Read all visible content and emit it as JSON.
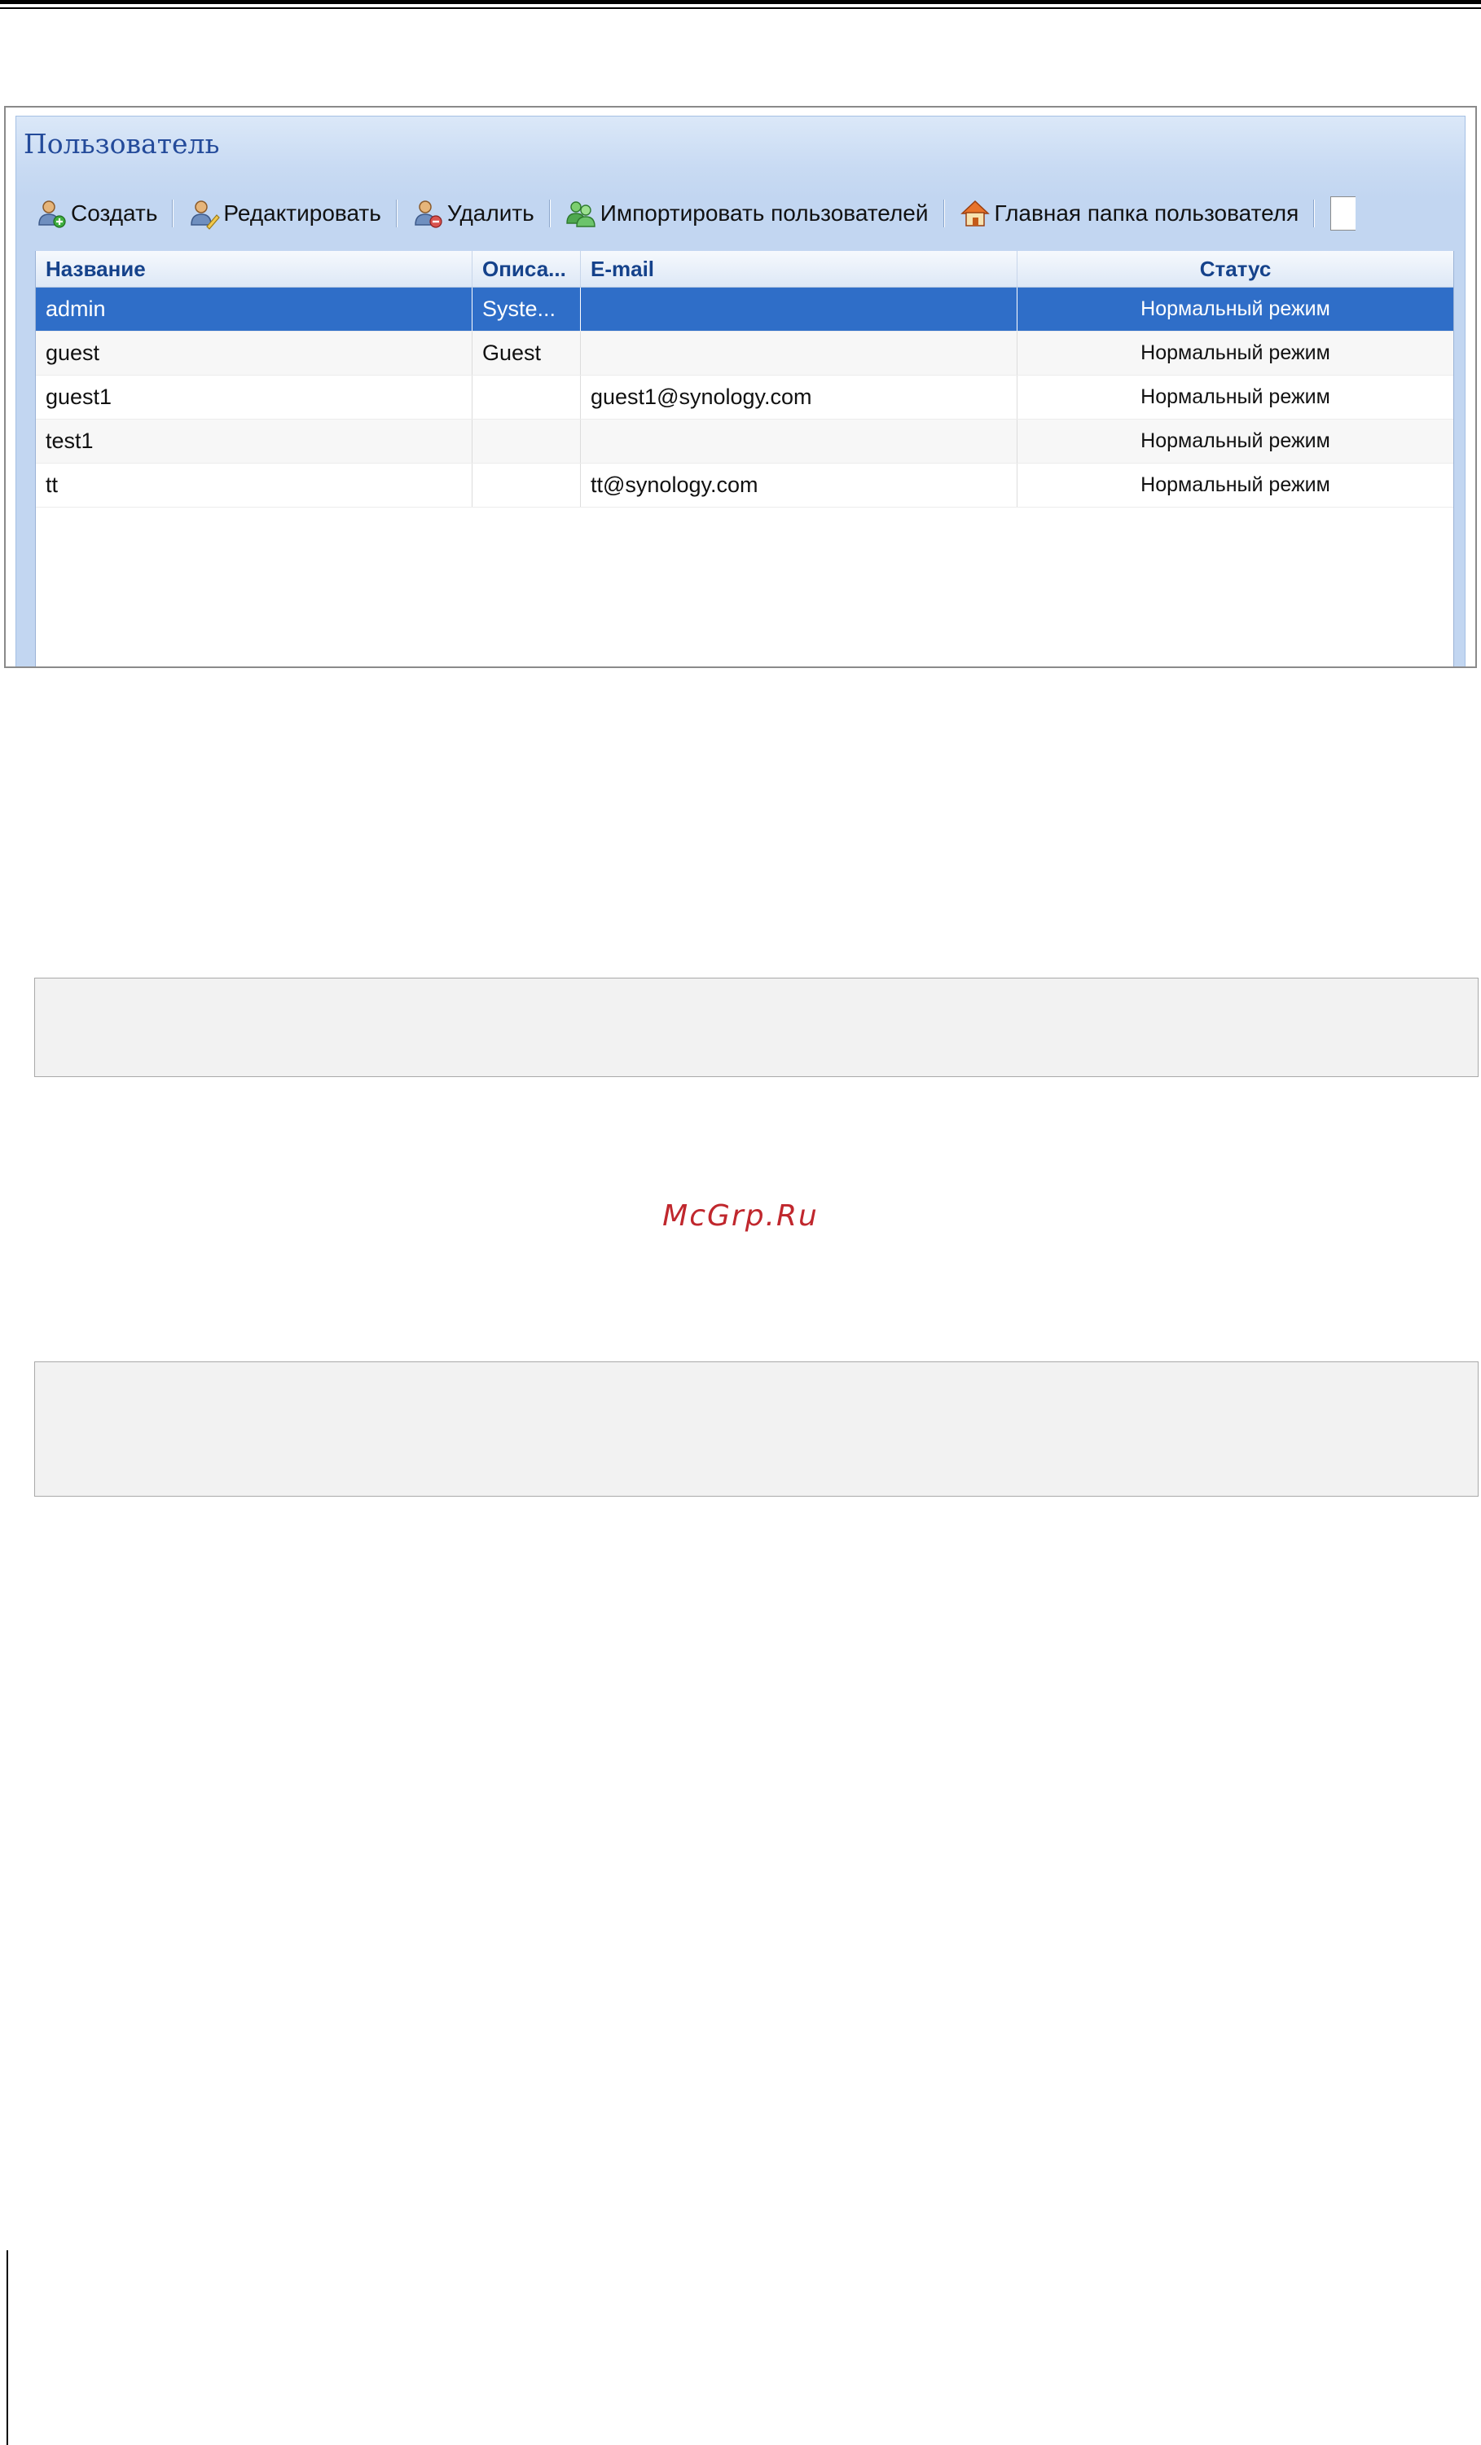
{
  "panel": {
    "title": "Пользователь"
  },
  "toolbar": {
    "create_label": "Создать",
    "edit_label": "Редактировать",
    "delete_label": "Удалить",
    "import_label": "Импортировать пользователей",
    "home_folder_label": "Главная папка пользователя"
  },
  "grid": {
    "columns": [
      "Название",
      "Описа...",
      "E-mail",
      "Статус"
    ],
    "rows": [
      {
        "name": "admin",
        "description": "Syste...",
        "email": "",
        "status": "Нормальный режим"
      },
      {
        "name": "guest",
        "description": "Guest",
        "email": "",
        "status": "Нормальный режим"
      },
      {
        "name": "guest1",
        "description": "",
        "email": "guest1@synology.com",
        "status": "Нормальный режим"
      },
      {
        "name": "test1",
        "description": "",
        "email": "",
        "status": "Нормальный режим"
      },
      {
        "name": "tt",
        "description": "",
        "email": "tt@synology.com",
        "status": "Нормальный режим"
      }
    ]
  },
  "watermark": "McGrp.Ru",
  "colors": {
    "title_blue": "#234a9a",
    "header_text": "#15428b",
    "selected_row": "#2f6ec8",
    "watermark_red": "#c0272d"
  },
  "icons": {
    "create": "user-add-icon",
    "edit": "user-edit-icon",
    "delete": "user-delete-icon",
    "import": "users-import-icon",
    "home": "home-icon"
  }
}
